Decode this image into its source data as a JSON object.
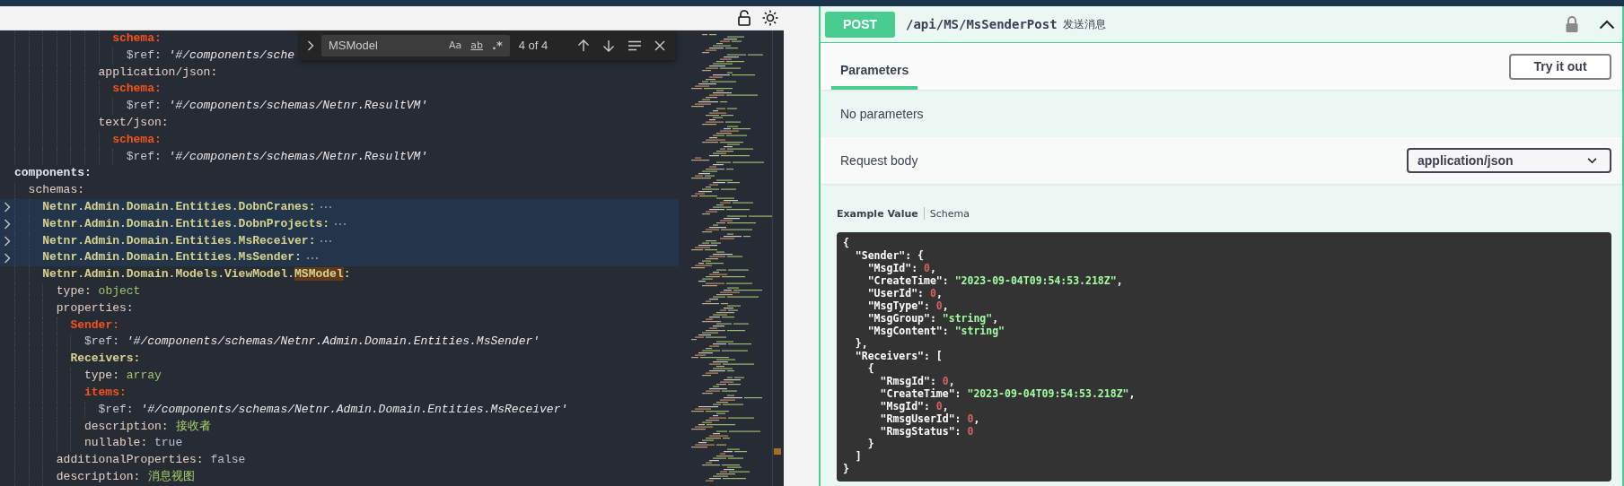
{
  "editor": {
    "code": [
      {
        "children": [
          {
            "children": [
              {
                "children": [
                  {
                    "children": [
                      {
                        "children": [
                          {
                            "children": [
                              {
                                "children": [
                                  {
                                    "key": "schema:",
                                    "kind": "section",
                                    "children": [
                                      {
                                        "key": "$ref:",
                                        "kind": "ref",
                                        "value": {
                                          "text": "'#/components/sche",
                                          "kind": "string"
                                        }
                                      }
                                    ]
                                  }
                                ]
                              },
                              {
                                "key": "application/json:",
                                "kind": "plain",
                                "children": [
                                  {
                                    "key": "schema:",
                                    "kind": "section",
                                    "children": [
                                      {
                                        "key": "$ref:",
                                        "kind": "ref",
                                        "value": {
                                          "text": "'#/components/schemas/Netnr.ResultVM'",
                                          "kind": "string"
                                        }
                                      }
                                    ]
                                  }
                                ]
                              },
                              {
                                "key": "text/json:",
                                "kind": "plain",
                                "children": [
                                  {
                                    "key": "schema:",
                                    "kind": "section",
                                    "children": [
                                      {
                                        "key": "$ref:",
                                        "kind": "ref",
                                        "value": {
                                          "text": "'#/components/schemas/Netnr.ResultVM'",
                                          "kind": "string"
                                        }
                                      }
                                    ]
                                  }
                                ]
                              }
                            ]
                          }
                        ]
                      }
                    ]
                  }
                ]
              }
            ]
          }
        ]
      },
      {
        "key": "components:",
        "kind": "root",
        "children": [
          {
            "key": "schemas:",
            "kind": "plain",
            "children": [
              {
                "key": "Netnr.Admin.Domain.Entities.DobnCranes:",
                "kind": "entity",
                "folded": true
              },
              {
                "key": "Netnr.Admin.Domain.Entities.DobnProjects:",
                "kind": "entity",
                "folded": true
              },
              {
                "key": "Netnr.Admin.Domain.Entities.MsReceiver:",
                "kind": "entity",
                "folded": true
              },
              {
                "key": "Netnr.Admin.Domain.Entities.MsSender:",
                "kind": "entity",
                "folded": true
              },
              {
                "key": "Netnr.Admin.Domain.Models.ViewModel.",
                "key_match": "MSModel",
                "key_rest": ":",
                "kind": "entity",
                "folded": false,
                "children": [
                  {
                    "key": "type:",
                    "kind": "plain",
                    "value": {
                      "text": "object",
                      "kind": "word"
                    }
                  },
                  {
                    "key": "properties:",
                    "kind": "plain",
                    "children": [
                      {
                        "key": "Sender:",
                        "kind": "section",
                        "children": [
                          {
                            "key": "$ref:",
                            "kind": "ref",
                            "value": {
                              "text": "'#/components/schemas/Netnr.Admin.Domain.Entities.MsSender'",
                              "kind": "string"
                            }
                          }
                        ]
                      },
                      {
                        "key": "Receivers:",
                        "kind": "entity",
                        "children": [
                          {
                            "key": "type:",
                            "kind": "plain",
                            "value": {
                              "text": "array",
                              "kind": "word"
                            }
                          },
                          {
                            "key": "items:",
                            "kind": "section",
                            "children": [
                              {
                                "key": "$ref:",
                                "kind": "ref",
                                "value": {
                                  "text": "'#/components/schemas/Netnr.Admin.Domain.Entities.MsReceiver'",
                                  "kind": "string"
                                }
                              }
                            ]
                          },
                          {
                            "key": "description:",
                            "kind": "plain",
                            "value": {
                              "text": "接收者",
                              "kind": "text"
                            }
                          },
                          {
                            "key": "nullable:",
                            "kind": "plain",
                            "value": {
                              "text": "true",
                              "kind": "bool"
                            }
                          }
                        ]
                      }
                    ]
                  },
                  {
                    "key": "additionalProperties:",
                    "kind": "plain",
                    "value": {
                      "text": "false",
                      "kind": "bool"
                    }
                  },
                  {
                    "key": "description:",
                    "kind": "plain",
                    "value": {
                      "text": "消息视图",
                      "kind": "text"
                    }
                  }
                ]
              }
            ]
          }
        ]
      }
    ],
    "find": {
      "query": "MSModel",
      "expanded": false,
      "options": [
        {
          "label": "Aa",
          "selected": false
        },
        {
          "label": "ab",
          "selected": false
        },
        {
          "label": ".*",
          "selected": false
        }
      ],
      "count": "4 of 4"
    }
  },
  "operation": {
    "kind": "post",
    "method": "POST",
    "path": "/api/MS/MsSenderPost",
    "summary": "发送消息",
    "expanded": true,
    "tabs": [
      {
        "label": "Parameters",
        "selected": true
      }
    ],
    "try_button": "Try it out",
    "no_params": "No parameters",
    "request_body_label": "Request body",
    "content_type": "application/json",
    "example_tabs": [
      {
        "label": "Example Value",
        "selected": true
      },
      {
        "label": "Schema",
        "selected": false
      }
    ],
    "example": [
      {
        "open": "{",
        "close": "}",
        "children": [
          {
            "key": "\"Sender\": ",
            "open": "{",
            "close": "},",
            "children": [
              {
                "key": "\"MsgId\": ",
                "value": "0",
                "kind": "number",
                "end": ","
              },
              {
                "key": "\"CreateTime\": ",
                "value": "\"2023-09-04T09:54:53.218Z\"",
                "kind": "string",
                "end": ","
              },
              {
                "key": "\"UserId\": ",
                "value": "0",
                "kind": "number",
                "end": ","
              },
              {
                "key": "\"MsgType\": ",
                "value": "0",
                "kind": "number",
                "end": ","
              },
              {
                "key": "\"MsgGroup\": ",
                "value": "\"string\"",
                "kind": "string",
                "end": ","
              },
              {
                "key": "\"MsgContent\": ",
                "value": "\"string\"",
                "kind": "string"
              }
            ]
          },
          {
            "key": "\"Receivers\": ",
            "open": "[",
            "close": "]",
            "children": [
              {
                "open": "{",
                "close": "}",
                "children": [
                  {
                    "key": "\"RmsgId\": ",
                    "value": "0",
                    "kind": "number",
                    "end": ","
                  },
                  {
                    "key": "\"CreateTime\": ",
                    "value": "\"2023-09-04T09:54:53.218Z\"",
                    "kind": "string",
                    "end": ","
                  },
                  {
                    "key": "\"MsgId\": ",
                    "value": "0",
                    "kind": "number",
                    "end": ","
                  },
                  {
                    "key": "\"RmsgUserId\": ",
                    "value": "0",
                    "kind": "number",
                    "end": ","
                  },
                  {
                    "key": "\"RmsgStatus\": ",
                    "value": "0",
                    "kind": "number"
                  }
                ]
              }
            ]
          }
        ]
      }
    ]
  }
}
